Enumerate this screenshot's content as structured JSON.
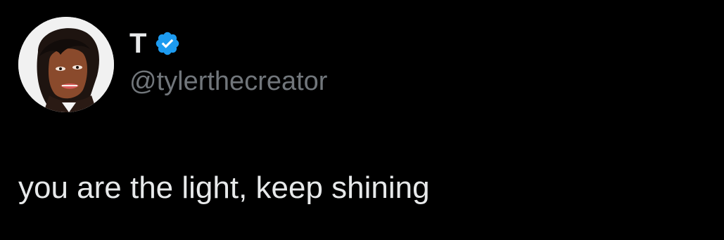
{
  "tweet": {
    "author": {
      "display_name": "T",
      "handle": "@tylerthecreator",
      "avatar_icon": "animated-portrait-avatar",
      "verified": true,
      "verified_icon": "verified-badge-icon",
      "verified_color": "#1d9bf0"
    },
    "text": "you are the light, keep shining"
  },
  "colors": {
    "background": "#000000",
    "primary_text": "#e7e9ea",
    "secondary_text": "#71767b",
    "accent": "#1d9bf0"
  }
}
